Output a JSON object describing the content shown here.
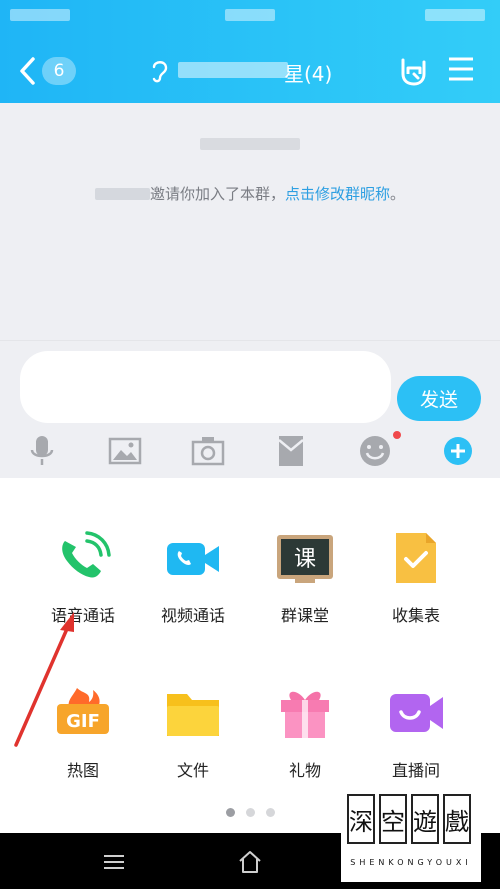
{
  "header": {
    "back_badge": "6",
    "title_suffix": "星(4)"
  },
  "chat": {
    "system_message": "邀请你加入了本群，",
    "system_link": "点击修改群昵称",
    "system_end": "。"
  },
  "input": {
    "placeholder": "",
    "send_label": "发送"
  },
  "toolbar": [
    "mic-icon",
    "image-icon",
    "camera-icon",
    "red-packet-icon",
    "emoji-icon",
    "plus-icon"
  ],
  "apps": [
    {
      "label": "语音通话",
      "icon": "phone-call-icon"
    },
    {
      "label": "视频通话",
      "icon": "video-call-icon"
    },
    {
      "label": "群课堂",
      "icon": "classroom-icon"
    },
    {
      "label": "收集表",
      "icon": "form-icon"
    },
    {
      "label": "热图",
      "icon": "gif-icon"
    },
    {
      "label": "文件",
      "icon": "folder-icon"
    },
    {
      "label": "礼物",
      "icon": "gift-icon"
    },
    {
      "label": "直播间",
      "icon": "live-icon"
    }
  ],
  "classroom_badge_text": "课",
  "gif_badge_text": "GIF",
  "pager": {
    "pages": 3,
    "current": 1
  },
  "watermark": {
    "chars": [
      "深",
      "空",
      "遊",
      "戲"
    ],
    "sub": "SHENKONGYOUXI"
  },
  "colors": {
    "header_blue": "#1fb5f6",
    "send_blue": "#2cc0f5",
    "link_blue": "#2d9fe2",
    "arrow_red": "#e0332e"
  }
}
